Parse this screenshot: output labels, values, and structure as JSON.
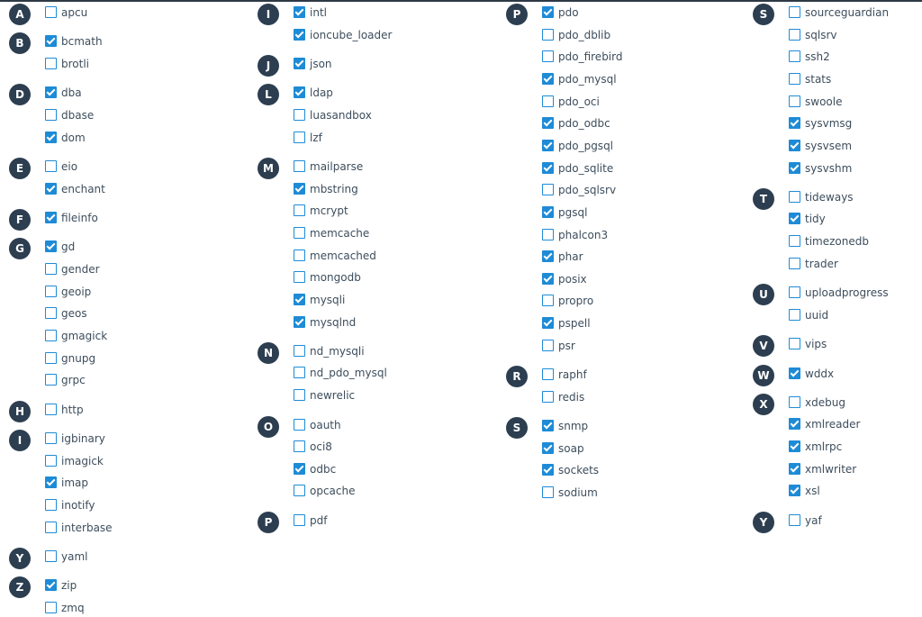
{
  "columns": [
    {
      "groups": [
        {
          "letter": "A",
          "items": [
            {
              "name": "apcu",
              "checked": false
            }
          ]
        },
        {
          "letter": "B",
          "items": [
            {
              "name": "bcmath",
              "checked": true
            },
            {
              "name": "brotli",
              "checked": false
            }
          ]
        },
        {
          "letter": "D",
          "items": [
            {
              "name": "dba",
              "checked": true
            },
            {
              "name": "dbase",
              "checked": false
            },
            {
              "name": "dom",
              "checked": true
            }
          ]
        },
        {
          "letter": "E",
          "items": [
            {
              "name": "eio",
              "checked": false
            },
            {
              "name": "enchant",
              "checked": true
            }
          ]
        },
        {
          "letter": "F",
          "items": [
            {
              "name": "fileinfo",
              "checked": true
            }
          ]
        },
        {
          "letter": "G",
          "items": [
            {
              "name": "gd",
              "checked": true
            },
            {
              "name": "gender",
              "checked": false
            },
            {
              "name": "geoip",
              "checked": false
            },
            {
              "name": "geos",
              "checked": false
            },
            {
              "name": "gmagick",
              "checked": false
            },
            {
              "name": "gnupg",
              "checked": false
            },
            {
              "name": "grpc",
              "checked": false
            }
          ]
        },
        {
          "letter": "H",
          "items": [
            {
              "name": "http",
              "checked": false
            }
          ]
        },
        {
          "letter": "I",
          "items": [
            {
              "name": "igbinary",
              "checked": false
            },
            {
              "name": "imagick",
              "checked": false
            },
            {
              "name": "imap",
              "checked": true
            },
            {
              "name": "inotify",
              "checked": false
            },
            {
              "name": "interbase",
              "checked": false
            }
          ]
        },
        {
          "letter": "Y",
          "items": [
            {
              "name": "yaml",
              "checked": false
            }
          ]
        },
        {
          "letter": "Z",
          "items": [
            {
              "name": "zip",
              "checked": true
            },
            {
              "name": "zmq",
              "checked": false
            }
          ]
        }
      ]
    },
    {
      "groups": [
        {
          "letter": "I",
          "items": [
            {
              "name": "intl",
              "checked": true
            },
            {
              "name": "ioncube_loader",
              "checked": true
            }
          ]
        },
        {
          "letter": "J",
          "items": [
            {
              "name": "json",
              "checked": true
            }
          ]
        },
        {
          "letter": "L",
          "items": [
            {
              "name": "ldap",
              "checked": true
            },
            {
              "name": "luasandbox",
              "checked": false
            },
            {
              "name": "lzf",
              "checked": false
            }
          ]
        },
        {
          "letter": "M",
          "items": [
            {
              "name": "mailparse",
              "checked": false
            },
            {
              "name": "mbstring",
              "checked": true
            },
            {
              "name": "mcrypt",
              "checked": false
            },
            {
              "name": "memcache",
              "checked": false
            },
            {
              "name": "memcached",
              "checked": false
            },
            {
              "name": "mongodb",
              "checked": false
            },
            {
              "name": "mysqli",
              "checked": true
            },
            {
              "name": "mysqlnd",
              "checked": true
            }
          ]
        },
        {
          "letter": "N",
          "items": [
            {
              "name": "nd_mysqli",
              "checked": false
            },
            {
              "name": "nd_pdo_mysql",
              "checked": false
            },
            {
              "name": "newrelic",
              "checked": false
            }
          ]
        },
        {
          "letter": "O",
          "items": [
            {
              "name": "oauth",
              "checked": false
            },
            {
              "name": "oci8",
              "checked": false
            },
            {
              "name": "odbc",
              "checked": true
            },
            {
              "name": "opcache",
              "checked": false
            }
          ]
        },
        {
          "letter": "P",
          "items": [
            {
              "name": "pdf",
              "checked": false
            }
          ]
        }
      ]
    },
    {
      "groups": [
        {
          "letter": "P",
          "items": [
            {
              "name": "pdo",
              "checked": true
            },
            {
              "name": "pdo_dblib",
              "checked": false
            },
            {
              "name": "pdo_firebird",
              "checked": false
            },
            {
              "name": "pdo_mysql",
              "checked": true
            },
            {
              "name": "pdo_oci",
              "checked": false
            },
            {
              "name": "pdo_odbc",
              "checked": true
            },
            {
              "name": "pdo_pgsql",
              "checked": true
            },
            {
              "name": "pdo_sqlite",
              "checked": true
            },
            {
              "name": "pdo_sqlsrv",
              "checked": false
            },
            {
              "name": "pgsql",
              "checked": true
            },
            {
              "name": "phalcon3",
              "checked": false
            },
            {
              "name": "phar",
              "checked": true
            },
            {
              "name": "posix",
              "checked": true
            },
            {
              "name": "propro",
              "checked": false
            },
            {
              "name": "pspell",
              "checked": true
            },
            {
              "name": "psr",
              "checked": false
            }
          ]
        },
        {
          "letter": "R",
          "items": [
            {
              "name": "raphf",
              "checked": false
            },
            {
              "name": "redis",
              "checked": false
            }
          ]
        },
        {
          "letter": "S",
          "items": [
            {
              "name": "snmp",
              "checked": true
            },
            {
              "name": "soap",
              "checked": true
            },
            {
              "name": "sockets",
              "checked": true
            },
            {
              "name": "sodium",
              "checked": false
            }
          ]
        }
      ]
    },
    {
      "groups": [
        {
          "letter": "S",
          "items": [
            {
              "name": "sourceguardian",
              "checked": false
            },
            {
              "name": "sqlsrv",
              "checked": false
            },
            {
              "name": "ssh2",
              "checked": false
            },
            {
              "name": "stats",
              "checked": false
            },
            {
              "name": "swoole",
              "checked": false
            },
            {
              "name": "sysvmsg",
              "checked": true
            },
            {
              "name": "sysvsem",
              "checked": true
            },
            {
              "name": "sysvshm",
              "checked": true
            }
          ]
        },
        {
          "letter": "T",
          "items": [
            {
              "name": "tideways",
              "checked": false
            },
            {
              "name": "tidy",
              "checked": true
            },
            {
              "name": "timezonedb",
              "checked": false
            },
            {
              "name": "trader",
              "checked": false
            }
          ]
        },
        {
          "letter": "U",
          "items": [
            {
              "name": "uploadprogress",
              "checked": false
            },
            {
              "name": "uuid",
              "checked": false
            }
          ]
        },
        {
          "letter": "V",
          "items": [
            {
              "name": "vips",
              "checked": false
            }
          ]
        },
        {
          "letter": "W",
          "items": [
            {
              "name": "wddx",
              "checked": true
            }
          ]
        },
        {
          "letter": "X",
          "items": [
            {
              "name": "xdebug",
              "checked": false
            },
            {
              "name": "xmlreader",
              "checked": true
            },
            {
              "name": "xmlrpc",
              "checked": true
            },
            {
              "name": "xmlwriter",
              "checked": true
            },
            {
              "name": "xsl",
              "checked": true
            }
          ]
        },
        {
          "letter": "Y",
          "items": [
            {
              "name": "yaf",
              "checked": false
            }
          ]
        }
      ]
    }
  ]
}
